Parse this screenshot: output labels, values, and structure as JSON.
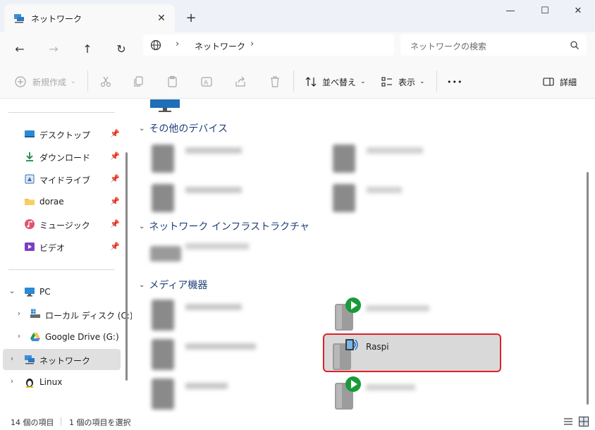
{
  "window": {
    "tab_title": "ネットワーク",
    "close_tab": "✕",
    "new_tab": "+",
    "minimize": "—",
    "maximize": "☐",
    "close": "✕"
  },
  "nav": {
    "back": "←",
    "forward": "→",
    "up": "↑",
    "refresh": "↻",
    "breadcrumb": "ネットワーク",
    "sep": "›",
    "search_placeholder": "ネットワークの検索"
  },
  "commands": {
    "new": "新規作成",
    "sort": "並べ替え",
    "view": "表示",
    "more": "•••",
    "details": "詳細"
  },
  "sidebar": {
    "quick": [
      {
        "label": "デスクトップ",
        "icon": "desktop-icon"
      },
      {
        "label": "ダウンロード",
        "icon": "download-icon"
      },
      {
        "label": "マイドライブ",
        "icon": "drive-icon"
      },
      {
        "label": "dorae",
        "icon": "folder-icon"
      },
      {
        "label": "ミュージック",
        "icon": "music-icon"
      },
      {
        "label": "ビデオ",
        "icon": "video-icon"
      }
    ],
    "tree": [
      {
        "label": "PC",
        "icon": "pc-icon"
      },
      {
        "label": "ローカル ディスク (C:)",
        "icon": "disk-icon"
      },
      {
        "label": "Google Drive (G:)",
        "icon": "google-drive-icon"
      },
      {
        "label": "ネットワーク",
        "icon": "network-icon"
      },
      {
        "label": "Linux",
        "icon": "linux-icon"
      }
    ]
  },
  "content": {
    "groups": [
      {
        "label": "その他のデバイス"
      },
      {
        "label": "ネットワーク インフラストラクチャ"
      },
      {
        "label": "メディア機器"
      }
    ],
    "selected_device": "Raspi"
  },
  "status": {
    "count": "14 個の項目",
    "selected": "1 個の項目を選択"
  },
  "colors": {
    "accent": "#0067c0",
    "group_header": "#1f3f78",
    "selection_outline": "#e0202a"
  }
}
